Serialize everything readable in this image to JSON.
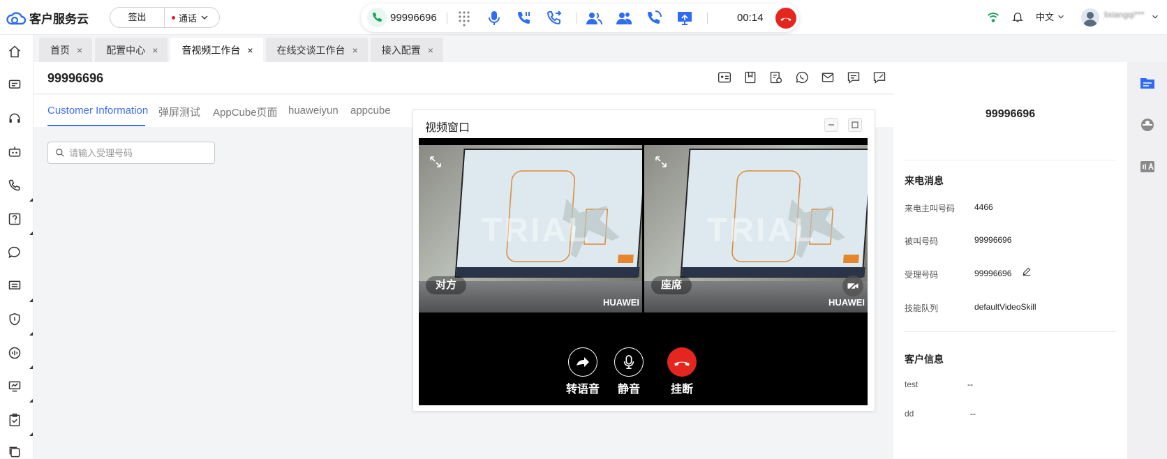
{
  "app": {
    "title": "客户服务云"
  },
  "topbar": {
    "signout_label": "签出",
    "status_label": "通话",
    "call_number": "99996696",
    "timer": "00:14",
    "language": "中文",
    "username": "lixiangqi***"
  },
  "tabs": [
    {
      "label": "首页",
      "close": "×"
    },
    {
      "label": "配置中心",
      "close": "×"
    },
    {
      "label": "音视频工作台",
      "close": "×",
      "active": true
    },
    {
      "label": "在线交谈工作台",
      "close": "×"
    },
    {
      "label": "接入配置",
      "close": "×"
    }
  ],
  "workbench": {
    "title": "99996696",
    "subtabs": [
      "Customer Information",
      "弹屏测试",
      "AppCube页面",
      "huaweiyun",
      "appcube"
    ],
    "search_placeholder": "请输入受理号码"
  },
  "video_window": {
    "title": "视频窗口",
    "remote_label": "对方",
    "local_label": "座席",
    "watermark": "TRIAL",
    "brand": "HUAWEI",
    "controls": {
      "transfer_label": "转语音",
      "mute_label": "静音",
      "hangup_label": "挂断"
    }
  },
  "right_panel": {
    "number": "99996696",
    "incoming_section": "来电消息",
    "fields": [
      {
        "key": "来电主叫号码",
        "value": "4466"
      },
      {
        "key": "被叫号码",
        "value": "99996696"
      },
      {
        "key": "受理号码",
        "value": "99996696"
      },
      {
        "key": "技能队列",
        "value": "defaultVideoSkill"
      }
    ],
    "customer_section": "客户信息",
    "customer_fields": [
      {
        "key": "test",
        "value": "--"
      },
      {
        "key": "dd",
        "value": "--"
      }
    ]
  },
  "colors": {
    "accent": "#3b6ff3",
    "hangup": "#e5261f",
    "online": "#1aa35a"
  }
}
